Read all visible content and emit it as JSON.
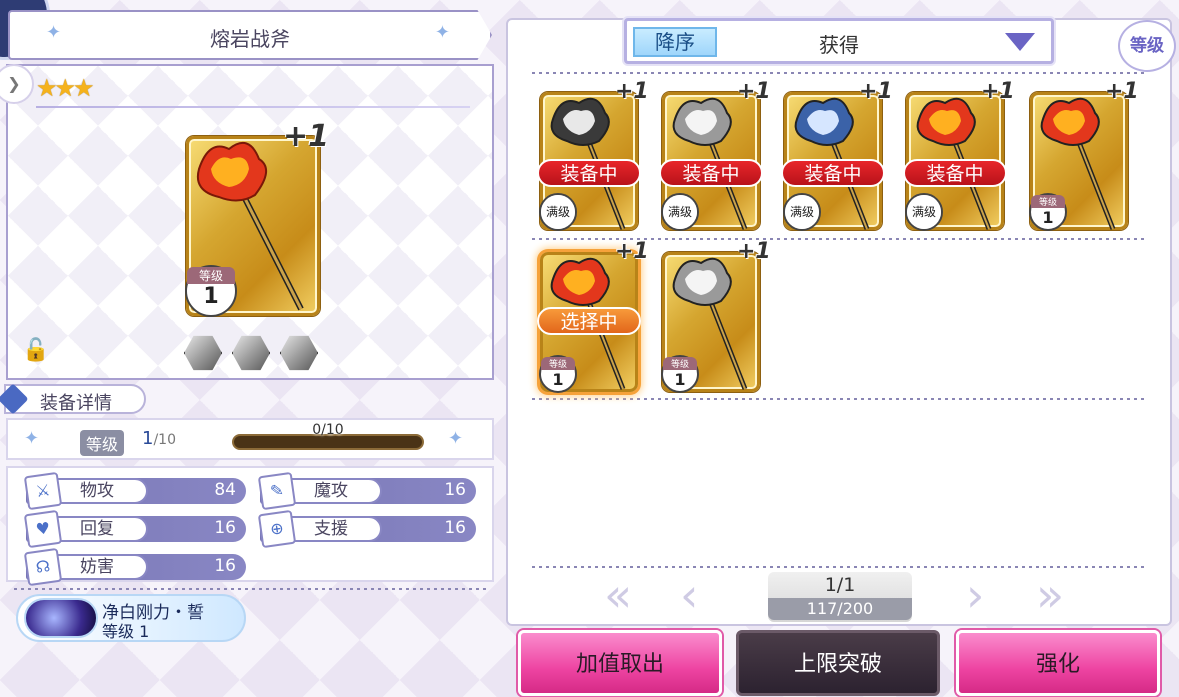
{
  "title": "熔岩战斧",
  "detail": {
    "plus": "+1",
    "stars": "★★★",
    "level_label": "等级",
    "level_value": "1"
  },
  "section_header": "装备详情",
  "level_row": {
    "label": "等级",
    "current": "1",
    "max": "/10",
    "exp": "0/10",
    "exp_fraction": 0
  },
  "stats": [
    {
      "name": "物攻",
      "value": "84",
      "icon": "sword-icon"
    },
    {
      "name": "魔攻",
      "value": "16",
      "icon": "wand-icon"
    },
    {
      "name": "回复",
      "value": "16",
      "icon": "heart-icon"
    },
    {
      "name": "支援",
      "value": "16",
      "icon": "target-icon"
    },
    {
      "name": "妨害",
      "value": "16",
      "icon": "disrupt-icon"
    }
  ],
  "skill": {
    "name": "净白刚力・誓",
    "level": "等级 1"
  },
  "sort": {
    "order": "降序",
    "criteria": "获得",
    "level_button": "等级"
  },
  "cards": [
    {
      "plus": "+1",
      "badge": "装备中",
      "badge_type": "equipped",
      "level_label": "满级",
      "level": "",
      "axe": "dark"
    },
    {
      "plus": "+1",
      "badge": "装备中",
      "badge_type": "equipped",
      "level_label": "满级",
      "level": "",
      "axe": "silver"
    },
    {
      "plus": "+1",
      "badge": "装备中",
      "badge_type": "equipped",
      "level_label": "满级",
      "level": "",
      "axe": "blue"
    },
    {
      "plus": "+1",
      "badge": "装备中",
      "badge_type": "equipped",
      "level_label": "满级",
      "level": "",
      "axe": "fire"
    },
    {
      "plus": "+1",
      "badge": "",
      "badge_type": "",
      "level_label": "等级",
      "level": "1",
      "axe": "fire"
    },
    {
      "plus": "+1",
      "badge": "选择中",
      "badge_type": "selected",
      "level_label": "等级",
      "level": "1",
      "axe": "fire"
    },
    {
      "plus": "+1",
      "badge": "",
      "badge_type": "",
      "level_label": "等级",
      "level": "1",
      "axe": "silver"
    }
  ],
  "pager": {
    "page": "1/1",
    "count": "117/200"
  },
  "buttons": {
    "withdraw": "加值取出",
    "limit_break": "上限突破",
    "enhance": "强化"
  }
}
